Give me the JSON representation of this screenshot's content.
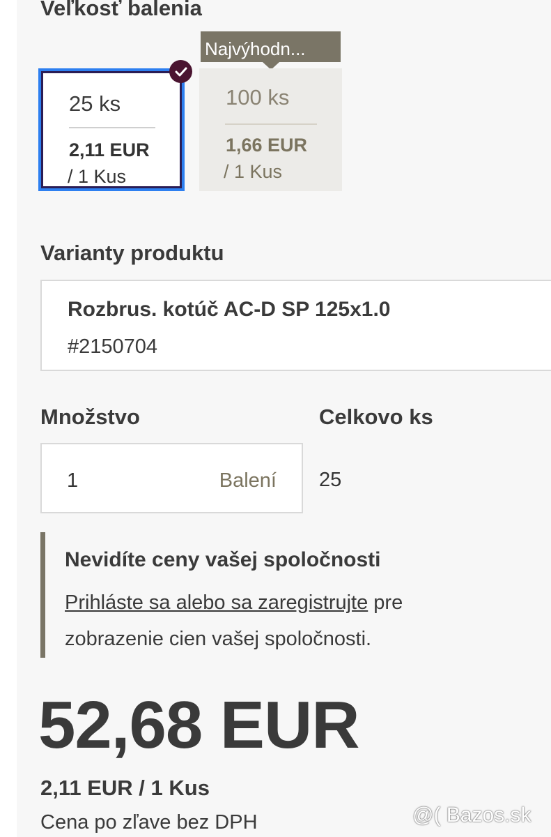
{
  "pack_size": {
    "title": "Veľkosť balenia",
    "best_label": "Najvýhodn...",
    "options": [
      {
        "qty": "25 ks",
        "price": "2,11 EUR",
        "unit": "/ 1 Kus",
        "selected": true
      },
      {
        "qty": "100 ks",
        "price": "1,66 EUR",
        "unit": "/ 1 Kus",
        "selected": false
      }
    ]
  },
  "variants": {
    "title": "Varianty produktu",
    "name": "Rozbrus. kotúč AC-D SP 125x1.0",
    "sku": "#2150704"
  },
  "quantity": {
    "title": "Množstvo",
    "value": "1",
    "unit": "Balení"
  },
  "total": {
    "title": "Celkovo ks",
    "value": "25"
  },
  "notice": {
    "title": "Nevidíte ceny vašej spoločnosti",
    "link": "Prihláste sa alebo sa zaregistrujte",
    "text_after_link": " pre zobrazenie cien vašej spoločnosti."
  },
  "price": {
    "total": "52,68 EUR",
    "per_unit": "2,11 EUR / 1 Kus",
    "note": "Cena po zľave bez DPH"
  },
  "watermark": "@( Bazos.sk",
  "colors": {
    "selected_border": "#2d7ff0",
    "badge": "#4a1430",
    "accent_taupe": "#7a7566"
  }
}
